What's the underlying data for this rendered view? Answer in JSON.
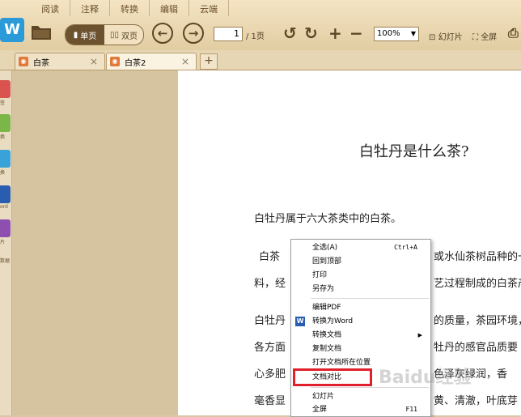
{
  "menubar": [
    "阅读",
    "注释",
    "转换",
    "编辑",
    "云端"
  ],
  "toolbar": {
    "app_logo": "W",
    "view_single": "单页",
    "view_double": "双页",
    "page_current": "1",
    "page_total": "/ 1页",
    "zoom": "100%",
    "slideshow": "幻灯片",
    "fullscreen": "全屏"
  },
  "tabs": [
    {
      "title": "白茶"
    },
    {
      "title": "白茶2"
    }
  ],
  "rail_labels": [
    "签",
    "换",
    "换",
    "ord",
    "片",
    "数据"
  ],
  "document": {
    "title": "白牡丹是什么茶?",
    "lines": [
      "白牡丹属于六大茶类中的白茶。",
      "白茶",
      "料，经",
      "白牡丹",
      "各方面",
      "心多肥",
      "毫香显"
    ],
    "lines_right": [
      "或水仙茶树品种的一",
      "艺过程制成的白茶产",
      "的质量，茶园环境，",
      "牡丹的感官品质要",
      "色泽灰绿润，香",
      "黄、清澈，叶底芽"
    ]
  },
  "context_menu": [
    {
      "label": "全选(A)",
      "shortcut": "Ctrl+A"
    },
    {
      "label": "回到顶部"
    },
    {
      "label": "打印"
    },
    {
      "label": "另存为"
    },
    {
      "label": "编辑PDF"
    },
    {
      "label": "转换为Word"
    },
    {
      "label": "转换文档"
    },
    {
      "label": "复制文档"
    },
    {
      "label": "打开文档所在位置"
    },
    {
      "label": "文档对比"
    },
    {
      "label": "幻灯片"
    },
    {
      "label": "全屏",
      "shortcut": "F11"
    }
  ],
  "watermark": "Baidu经验",
  "colors": {
    "highlight": "#e0202a",
    "accent": "#6d5230"
  }
}
